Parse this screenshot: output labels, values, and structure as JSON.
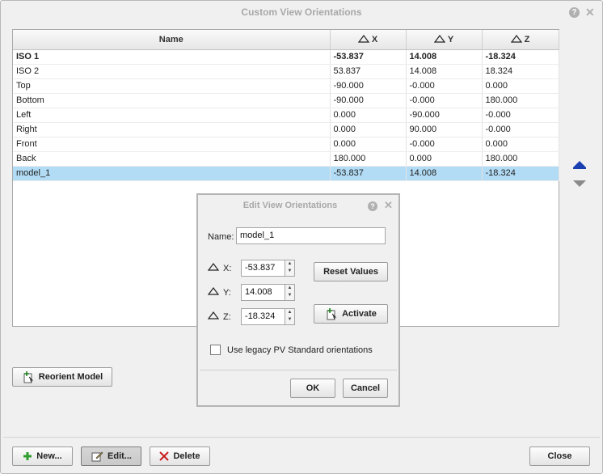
{
  "window": {
    "title": "Custom View Orientations",
    "help_icon": "?",
    "close_icon": "✕"
  },
  "table": {
    "columns": [
      "Name",
      "X",
      "Y",
      "Z"
    ],
    "rows": [
      {
        "name": "ISO 1",
        "x": "-53.837",
        "y": "14.008",
        "z": "-18.324",
        "bold": true
      },
      {
        "name": "ISO 2",
        "x": "53.837",
        "y": "14.008",
        "z": "18.324"
      },
      {
        "name": "Top",
        "x": "-90.000",
        "y": "-0.000",
        "z": "0.000"
      },
      {
        "name": "Bottom",
        "x": "-90.000",
        "y": "-0.000",
        "z": "180.000"
      },
      {
        "name": "Left",
        "x": "0.000",
        "y": "-90.000",
        "z": "-0.000"
      },
      {
        "name": "Right",
        "x": "0.000",
        "y": "90.000",
        "z": "-0.000"
      },
      {
        "name": "Front",
        "x": "0.000",
        "y": "-0.000",
        "z": "0.000"
      },
      {
        "name": "Back",
        "x": "180.000",
        "y": "0.000",
        "z": "180.000"
      },
      {
        "name": "model_1",
        "x": "-53.837",
        "y": "14.008",
        "z": "-18.324",
        "selected": true
      }
    ],
    "selected_color": "#b2dcf5"
  },
  "reorient_button": "Reorient Model",
  "footer": {
    "new_label": "New...",
    "edit_label": "Edit...",
    "delete_label": "Delete",
    "close_label": "Close"
  },
  "dialog": {
    "title": "Edit View Orientations",
    "name_label": "Name:",
    "name_value": "model_1",
    "x_label": "X:",
    "x_value": "-53.837",
    "y_label": "Y:",
    "y_value": "14.008",
    "z_label": "Z:",
    "z_value": "-18.324",
    "reset_label": "Reset Values",
    "activate_label": "Activate",
    "legacy_label": "Use legacy PV Standard orientations",
    "legacy_checked": false,
    "ok_label": "OK",
    "cancel_label": "Cancel"
  },
  "colors": {
    "move_up_arrow": "#1a3fb0",
    "move_down_arrow": "#8a8a8a",
    "new_plus": "#2e9e2e",
    "delete_x": "#c81e1e"
  }
}
